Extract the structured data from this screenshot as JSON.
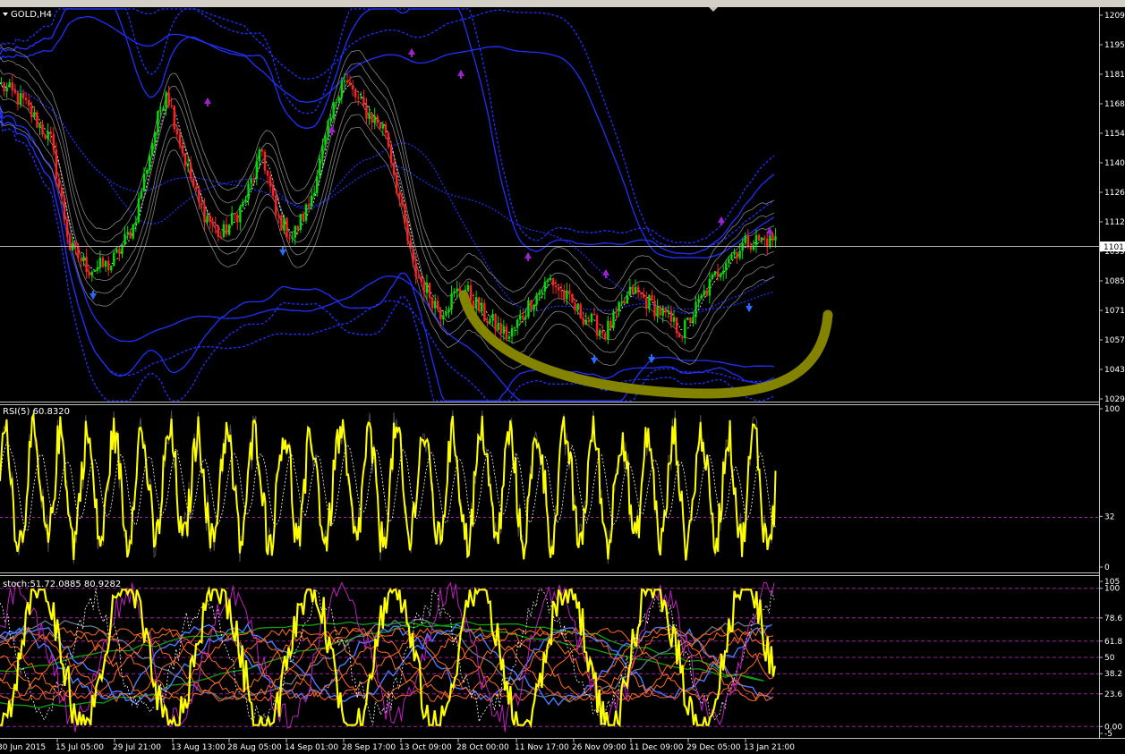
{
  "window": {
    "symbol_title": "GOLD,H4"
  },
  "colors": {
    "background": "#000000",
    "price_bull": "#00e000",
    "price_bear": "#ff2020",
    "bands_blue": "#2030ff",
    "envelope_gray": "#b0b0b0",
    "rsi_line": "#ffff00",
    "stoch_main": "#ffff00",
    "stoch_orange": "#ff6a20",
    "stoch_blue": "#4a7aff",
    "stoch_green": "#10a010",
    "level_magenta": "#a020a0",
    "annotation_arc": "#8a8a00",
    "arrow_up": "#2a6aff",
    "arrow_down": "#a020d0"
  },
  "icons": {
    "arrow_up": "up-arrow-icon",
    "arrow_down": "down-arrow-icon",
    "menu": "triangle-down-icon"
  },
  "chart_data": [
    {
      "type": "candlestick",
      "symbol": "GOLD",
      "timeframe": "H4",
      "title": "GOLD,H4",
      "yticks": [
        "1209.",
        "1195.",
        "1181.",
        "1168.",
        "1154.",
        "1140.",
        "1126.",
        "1112.",
        "1099.",
        "1085.",
        "1071.",
        "1057.",
        "1043.",
        "1029."
      ],
      "current_price_label": "1101.",
      "ylim": [
        1029,
        1209
      ],
      "grid": false,
      "close_path": [
        [
          0,
          1176
        ],
        [
          8,
          1168
        ],
        [
          18,
          1150
        ],
        [
          25,
          1100
        ],
        [
          32,
          1090
        ],
        [
          40,
          1092
        ],
        [
          48,
          1110
        ],
        [
          55,
          1150
        ],
        [
          60,
          1175
        ],
        [
          66,
          1145
        ],
        [
          72,
          1120
        ],
        [
          80,
          1105
        ],
        [
          88,
          1120
        ],
        [
          95,
          1145
        ],
        [
          100,
          1115
        ],
        [
          106,
          1105
        ],
        [
          112,
          1120
        ],
        [
          118,
          1150
        ],
        [
          124,
          1180
        ],
        [
          132,
          1165
        ],
        [
          140,
          1155
        ],
        [
          150,
          1090
        ],
        [
          160,
          1070
        ],
        [
          168,
          1082
        ],
        [
          176,
          1068
        ],
        [
          185,
          1058
        ],
        [
          193,
          1075
        ],
        [
          200,
          1085
        ],
        [
          210,
          1070
        ],
        [
          220,
          1060
        ],
        [
          230,
          1080
        ],
        [
          240,
          1070
        ],
        [
          248,
          1060
        ],
        [
          256,
          1078
        ],
        [
          264,
          1095
        ],
        [
          272,
          1103
        ],
        [
          282,
          1104
        ]
      ],
      "indicators": [
        "Bollinger bands (blue)",
        "Price envelopes (gray)",
        "Fractal arrows"
      ]
    },
    {
      "type": "line",
      "name": "RSI(5)",
      "label": "RSI(5) 60.8320",
      "value": 60.832,
      "yticks": [
        "100",
        "32",
        "0"
      ],
      "levels": [
        32
      ],
      "ylim": [
        0,
        100
      ]
    },
    {
      "type": "line",
      "name": "stoch",
      "label": "stoch:51.72.0885 80.9282",
      "yticks": [
        "105",
        "100",
        "78.6",
        "61.8",
        "50",
        "38.2",
        "23.6",
        "0.00",
        "-5"
      ],
      "levels": [
        100,
        78.6,
        61.8,
        50,
        38.2,
        23.6,
        0
      ],
      "ylim": [
        -5,
        105
      ]
    }
  ],
  "xaxis": {
    "tick_labels": [
      "30 Jun 2015",
      "15 Jul 05:00",
      "29 Jul 21:00",
      "13 Aug 13:00",
      "28 Aug 05:00",
      "14 Sep 01:00",
      "28 Sep 17:00",
      "13 Oct 09:00",
      "28 Oct 00:00",
      "11 Nov 17:00",
      "26 Nov 09:00",
      "11 Dec 09:00",
      "29 Dec 05:00",
      "13 Jan 21:00"
    ]
  }
}
